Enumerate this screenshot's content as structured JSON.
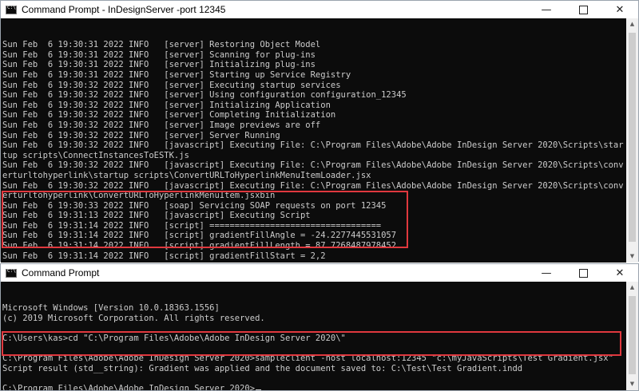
{
  "top_window": {
    "title": "Command Prompt - InDesignServer  -port 12345",
    "minimize_icon": "minimize-icon",
    "maximize_icon": "maximize-icon",
    "close_icon": "close-icon",
    "lines": [
      "Sun Feb  6 19:30:31 2022 INFO   [server] Restoring Object Model",
      "Sun Feb  6 19:30:31 2022 INFO   [server] Scanning for plug-ins",
      "Sun Feb  6 19:30:31 2022 INFO   [server] Initializing plug-ins",
      "Sun Feb  6 19:30:31 2022 INFO   [server] Starting up Service Registry",
      "Sun Feb  6 19:30:32 2022 INFO   [server] Executing startup services",
      "Sun Feb  6 19:30:32 2022 INFO   [server] Using configuration configuration_12345",
      "Sun Feb  6 19:30:32 2022 INFO   [server] Initializing Application",
      "Sun Feb  6 19:30:32 2022 INFO   [server] Completing Initialization",
      "Sun Feb  6 19:30:32 2022 INFO   [server] Image previews are off",
      "Sun Feb  6 19:30:32 2022 INFO   [server] Server Running",
      "Sun Feb  6 19:30:32 2022 INFO   [javascript] Executing File: C:\\Program Files\\Adobe\\Adobe InDesign Server 2020\\Scripts\\star",
      "tup scripts\\ConnectInstancesToESTK.js",
      "Sun Feb  6 19:30:32 2022 INFO   [javascript] Executing File: C:\\Program Files\\Adobe\\Adobe InDesign Server 2020\\Scripts\\conv",
      "erturltohyperlink\\startup scripts\\ConvertURLToHyperlinkMenuItemLoader.jsx",
      "Sun Feb  6 19:30:32 2022 INFO   [javascript] Executing File: C:\\Program Files\\Adobe\\Adobe InDesign Server 2020\\Scripts\\conv",
      "erturltohyperlink\\ConvertURLToHyperlinkMenuItem.jsxbin",
      "Sun Feb  6 19:30:33 2022 INFO   [soap] Servicing SOAP requests on port 12345",
      "Sun Feb  6 19:31:13 2022 INFO   [javascript] Executing Script",
      "Sun Feb  6 19:31:14 2022 INFO   [script] ==================================",
      "Sun Feb  6 19:31:14 2022 INFO   [script] gradientFillAngle = -24.2277445531057",
      "Sun Feb  6 19:31:14 2022 INFO   [script] gradientFillLength = 87.7268487978452",
      "Sun Feb  6 19:31:14 2022 INFO   [script] gradientFillStart = 2,2"
    ]
  },
  "bottom_window": {
    "title": "Command Prompt",
    "minimize_icon": "minimize-icon",
    "maximize_icon": "maximize-icon",
    "close_icon": "close-icon",
    "lines": [
      "Microsoft Windows [Version 10.0.18363.1556]",
      "(c) 2019 Microsoft Corporation. All rights reserved.",
      "",
      "C:\\Users\\kas>cd \"C:\\Program Files\\Adobe\\Adobe InDesign Server 2020\\\"",
      "",
      "C:\\Program Files\\Adobe\\Adobe InDesign Server 2020>sampleclient -host localhost:12345 \"c:\\myJavaScripts\\Test Gradient.jsx\"",
      "Script result (std__string): Gradient was applied and the document saved to: C:\\Test\\Test Gradient.indd",
      "",
      "C:\\Program Files\\Adobe\\Adobe InDesign Server 2020>"
    ]
  },
  "colors": {
    "console_bg": "#0c0c0c",
    "console_text": "#cccccc",
    "highlight": "#e0383e"
  }
}
